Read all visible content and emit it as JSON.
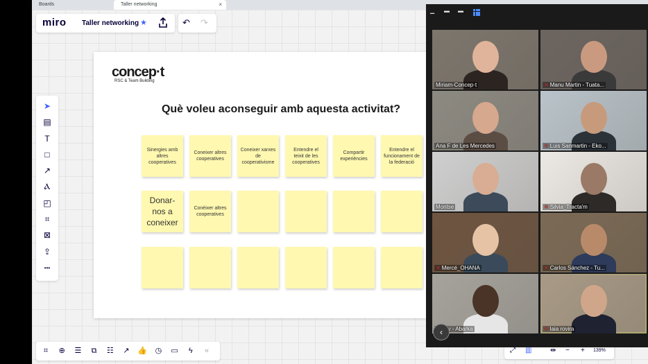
{
  "browser": {
    "tabs": [
      {
        "label": "Boards"
      },
      {
        "label": "Taller networking",
        "close": "×"
      }
    ]
  },
  "header": {
    "logo": "miro",
    "board_title": "Taller networking",
    "star_icon": "star-icon",
    "share_icon": "upload-icon"
  },
  "history": {
    "undo": "↶",
    "redo": "↷"
  },
  "tools": [
    {
      "name": "select-tool",
      "glyph": "➤"
    },
    {
      "name": "templates-tool",
      "glyph": "▤"
    },
    {
      "name": "text-tool",
      "glyph": "T"
    },
    {
      "name": "shape-tool",
      "glyph": "□"
    },
    {
      "name": "connector-tool",
      "glyph": "↗"
    },
    {
      "name": "pen-tool",
      "glyph": "Ⲁ"
    },
    {
      "name": "sticky-note-tool",
      "glyph": "◰"
    },
    {
      "name": "frame-tool",
      "glyph": "⌗"
    },
    {
      "name": "crop-tool",
      "glyph": "⊠"
    },
    {
      "name": "upload-tool",
      "glyph": "⇪"
    },
    {
      "name": "more-tool",
      "glyph": "•••"
    }
  ],
  "bottom_tools": [
    "⌗",
    "⊕",
    "☰",
    "⧉",
    "☷",
    "↗",
    "👍",
    "◷",
    "▭",
    "ϟ",
    "«"
  ],
  "frame": {
    "brand": "concep·t",
    "brand_sub": "RSC & Team Building",
    "question": "Què voleu aconseguir amb aquesta activitat?",
    "notes_row1": [
      "Sinergies amb altres cooperatives",
      "Coneixer altres cooperatives",
      "Coneixer xarxes de cooperativisme",
      "Entendre el teixit de les cooperatives",
      "Compartir experiències",
      "Entendre el funcionament de la federació"
    ],
    "notes_row2": [
      "Donar-nos a coneixer",
      "Conèixer altres cooperatives",
      "",
      "",
      "",
      ""
    ],
    "notes_row3": [
      "",
      "",
      "",
      "",
      "",
      ""
    ]
  },
  "zoom": {
    "participants": [
      {
        "name": "Miriam-Concep·t",
        "muted": false
      },
      {
        "name": "Manu Martin - Tuata...",
        "muted": true
      },
      {
        "name": "Ana F de Les Mercedes",
        "muted": false
      },
      {
        "name": "Luis Sanmartin - Eko...",
        "muted": true
      },
      {
        "name": "Montse",
        "muted": false
      },
      {
        "name": "Silvia_Tracta'm",
        "muted": true
      },
      {
        "name": "Mercé_OHANA",
        "muted": true
      },
      {
        "name": "Carlos Sánchez - Tu...",
        "muted": true
      },
      {
        "name": "ady - Abarka",
        "muted": true
      },
      {
        "name": "laia rovira",
        "muted": true
      }
    ],
    "back": "‹"
  },
  "zoom_controls": {
    "pct": "139%",
    "minus": "−",
    "plus": "+"
  }
}
